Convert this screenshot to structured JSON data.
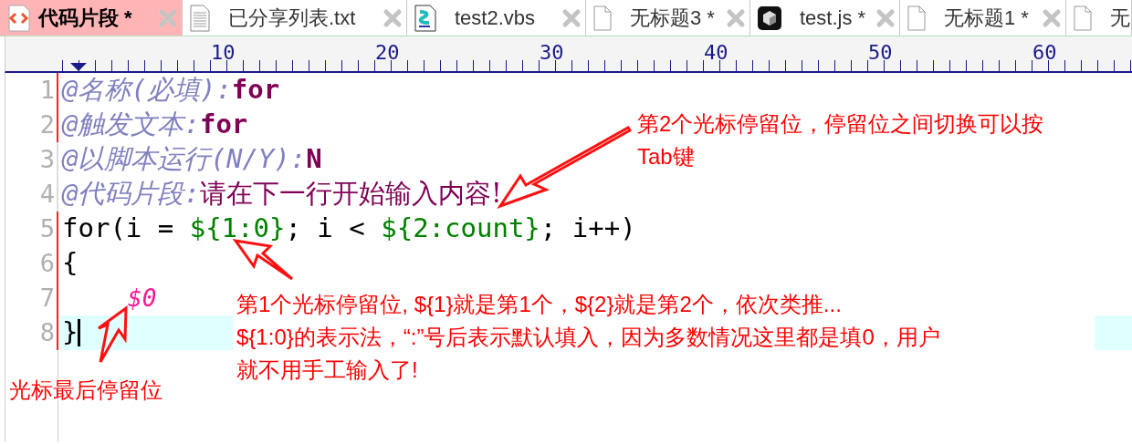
{
  "tabs": [
    {
      "label": "代码片段 *",
      "kind": "snippet",
      "selected": true,
      "closable": true
    },
    {
      "label": "已分享列表.txt",
      "kind": "text",
      "selected": false,
      "closable": true
    },
    {
      "label": "test2.vbs",
      "kind": "script",
      "selected": false,
      "closable": true
    },
    {
      "label": "无标题3 *",
      "kind": "blank",
      "selected": false,
      "closable": true
    },
    {
      "label": "test.js *",
      "kind": "cube",
      "selected": false,
      "closable": true
    },
    {
      "label": "无标题1 *",
      "kind": "blank",
      "selected": false,
      "closable": true
    },
    {
      "label": "无",
      "kind": "blank",
      "selected": false,
      "closable": false
    }
  ],
  "ruler": {
    "numbers": [
      "10",
      "20",
      "30",
      "40",
      "50",
      "60"
    ]
  },
  "lines": [
    {
      "number": "1",
      "modified": true,
      "current": false,
      "tokens": [
        {
          "kind": "meta",
          "text": "@名称(必填):"
        },
        {
          "kind": "value",
          "text": "for"
        }
      ]
    },
    {
      "number": "2",
      "modified": true,
      "current": false,
      "tokens": [
        {
          "kind": "meta",
          "text": "@触发文本:"
        },
        {
          "kind": "value",
          "text": "for"
        }
      ]
    },
    {
      "number": "3",
      "modified": false,
      "current": false,
      "tokens": [
        {
          "kind": "meta",
          "text": "@以脚本运行(N/Y):"
        },
        {
          "kind": "value",
          "text": "N"
        }
      ]
    },
    {
      "number": "4",
      "modified": false,
      "current": false,
      "tokens": [
        {
          "kind": "meta",
          "text": "@代码片段:"
        },
        {
          "kind": "note",
          "text": "请在下一行开始输入内容!"
        }
      ]
    },
    {
      "number": "5",
      "modified": true,
      "current": false,
      "tokens": [
        {
          "kind": "code",
          "text": "for(i = "
        },
        {
          "kind": "placeholder",
          "text": "${1:0}"
        },
        {
          "kind": "code",
          "text": "; i < "
        },
        {
          "kind": "placeholder",
          "text": "${2:count}"
        },
        {
          "kind": "code",
          "text": "; i++)"
        }
      ]
    },
    {
      "number": "6",
      "modified": true,
      "current": false,
      "tokens": [
        {
          "kind": "code",
          "text": "{"
        }
      ]
    },
    {
      "number": "7",
      "modified": true,
      "current": false,
      "tokens": [
        {
          "kind": "final_stop",
          "text": "$0"
        }
      ]
    },
    {
      "number": "8",
      "modified": true,
      "current": true,
      "tokens": [
        {
          "kind": "code",
          "text": "}"
        }
      ]
    }
  ],
  "annotations": [
    {
      "kind": "second_stop",
      "lines": [
        "第2个光标停留位，停留位之间切换可以按",
        "Tab键"
      ]
    },
    {
      "kind": "first_stop",
      "lines": [
        "第1个光标停留位, ${1}就是第1个，${2}就是第2个，依次类推...",
        "${1:0}的表示法，“:”号后表示默认填入，因为多数情况这里都是填0，用户",
        "就不用手工输入了!"
      ]
    },
    {
      "kind": "last_stop",
      "lines": [
        "光标最后停留位"
      ]
    }
  ]
}
